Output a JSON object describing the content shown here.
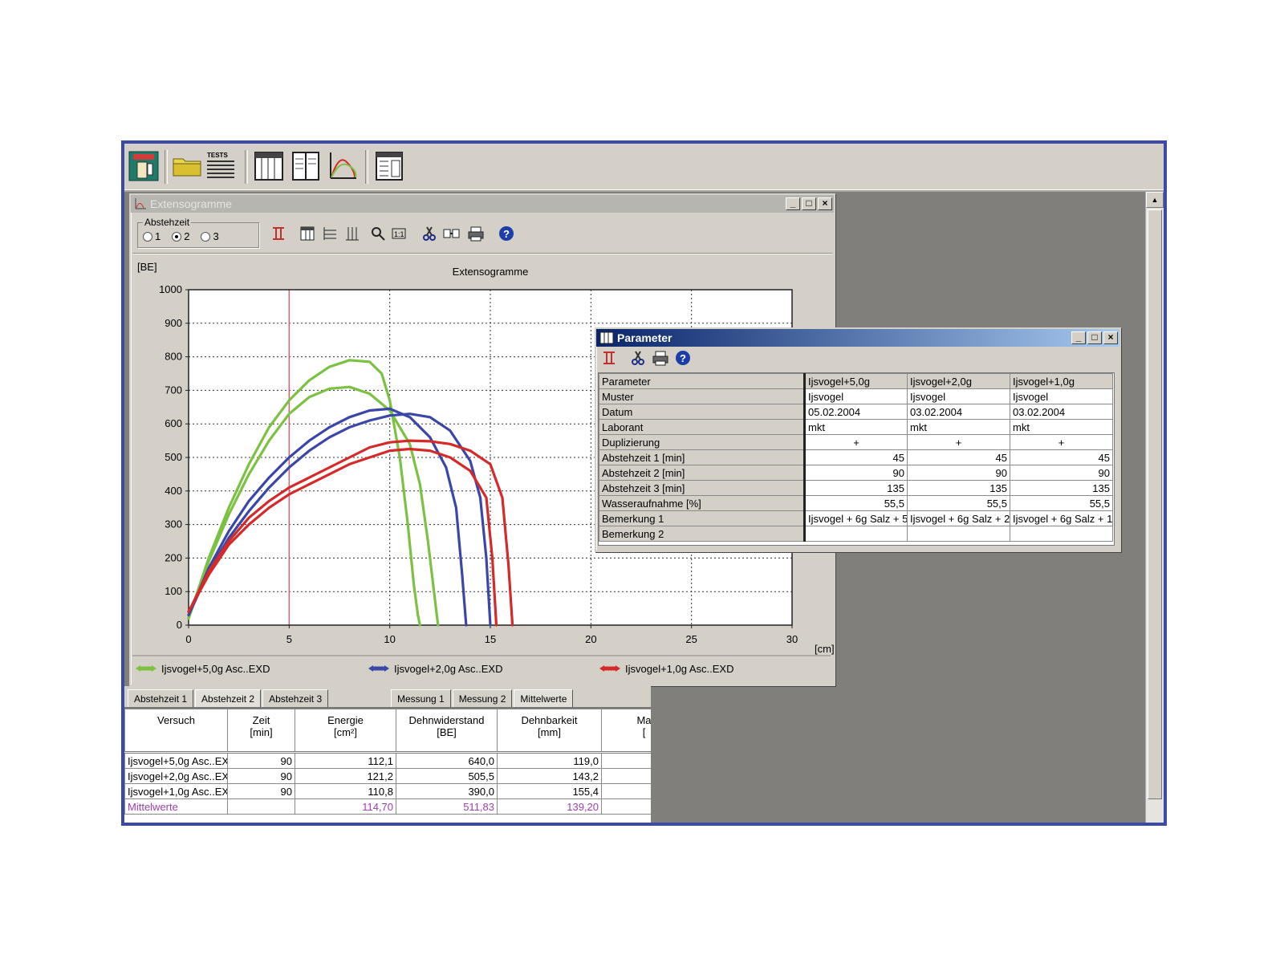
{
  "parameter_window": {
    "title": "Parameter",
    "headers": [
      "Parameter",
      "Ijsvogel+5,0g",
      "Ijsvogel+2,0g",
      "Ijsvogel+1,0g"
    ],
    "rows": [
      [
        "Muster",
        "Ijsvogel",
        "Ijsvogel",
        "Ijsvogel"
      ],
      [
        "Datum",
        "05.02.2004",
        "03.02.2004",
        "03.02.2004"
      ],
      [
        "Laborant",
        "mkt",
        "mkt",
        "mkt"
      ],
      [
        "Duplizierung",
        "+",
        "+",
        "+"
      ],
      [
        "Abstehzeit 1 [min]",
        "45",
        "45",
        "45"
      ],
      [
        "Abstehzeit 2 [min]",
        "90",
        "90",
        "90"
      ],
      [
        "Abstehzeit 3 [min]",
        "135",
        "135",
        "135"
      ],
      [
        "Wasseraufnahme [%]",
        "55,5",
        "55,5",
        "55,5"
      ],
      [
        "Bemerkung 1",
        "Ijsvogel + 6g Salz + 5",
        "Ijsvogel + 6g Salz + 2",
        "Ijsvogel + 6g Salz + 1"
      ],
      [
        "Bemerkung 2",
        "",
        "",
        ""
      ]
    ]
  },
  "results": {
    "tabs_left": [
      "Abstehzeit 1",
      "Abstehzeit 2",
      "Abstehzeit 3"
    ],
    "tabs_right": [
      "Messung 1",
      "Messung 2",
      "Mittelwerte"
    ],
    "headers": [
      {
        "line1": "Versuch",
        "line2": ""
      },
      {
        "line1": "Zeit",
        "line2": "[min]"
      },
      {
        "line1": "Energie",
        "line2": "[cm²]"
      },
      {
        "line1": "Dehnwiderstand",
        "line2": "[BE]"
      },
      {
        "line1": "Dehnbarkeit",
        "line2": "[mm]"
      },
      {
        "line1": "Ma",
        "line2": "["
      }
    ],
    "rows": [
      [
        "Ijsvogel+5,0g Asc..EXD",
        "90",
        "112,1",
        "640,0",
        "119,0",
        ""
      ],
      [
        "Ijsvogel+2,0g Asc..EXD",
        "90",
        "121,2",
        "505,5",
        "143,2",
        ""
      ],
      [
        "Ijsvogel+1,0g Asc..EXD",
        "90",
        "110,8",
        "390,0",
        "155,4",
        ""
      ]
    ],
    "mean_row": [
      "Mittelwerte",
      "",
      "114,70",
      "511,83",
      "139,20",
      ""
    ]
  },
  "colors": {
    "green": "#7cc142",
    "blue": "#3a46a8",
    "red": "#d42a2a",
    "marker": "#e06070",
    "mean_text": "#a040b0"
  },
  "chart_data": {
    "type": "line",
    "title": "Extensogramme",
    "ylabel": "[BE]",
    "xlabel": "[cm]",
    "xlim": [
      0,
      30
    ],
    "ylim": [
      0,
      1000
    ],
    "xticks": [
      0,
      5,
      10,
      15,
      20,
      25,
      30
    ],
    "yticks": [
      0,
      100,
      200,
      300,
      400,
      500,
      600,
      700,
      800,
      900,
      1000
    ],
    "grid": true,
    "marker_x": 5,
    "series": [
      {
        "name": "Ijsvogel+5,0g Asc..EXD",
        "color": "green",
        "x": [
          0,
          1,
          2,
          3,
          4,
          5,
          6,
          7,
          8,
          9,
          9.6,
          10,
          10.5,
          10.9,
          11.2,
          11.4,
          11.5
        ],
        "y": [
          20,
          200,
          350,
          480,
          590,
          670,
          730,
          770,
          790,
          785,
          750,
          670,
          500,
          300,
          120,
          30,
          0
        ]
      },
      {
        "name": "Ijsvogel+5,0g Asc..EXD",
        "color": "green",
        "x": [
          0,
          1,
          2,
          3,
          4,
          5,
          6,
          7,
          8,
          9,
          10,
          11,
          11.5,
          11.9,
          12.2,
          12.4
        ],
        "y": [
          20,
          190,
          330,
          450,
          550,
          630,
          680,
          705,
          710,
          690,
          640,
          540,
          420,
          250,
          100,
          0
        ]
      },
      {
        "name": "Ijsvogel+2,0g Asc..EXD",
        "color": "blue",
        "x": [
          0,
          1,
          2,
          3,
          4,
          5,
          6,
          7,
          8,
          9,
          10,
          11,
          12,
          12.8,
          13.3,
          13.6,
          13.8
        ],
        "y": [
          30,
          170,
          280,
          370,
          440,
          500,
          550,
          590,
          620,
          640,
          645,
          620,
          560,
          470,
          350,
          150,
          0
        ]
      },
      {
        "name": "Ijsvogel+2,0g Asc..EXD",
        "color": "blue",
        "x": [
          0,
          1,
          2,
          3,
          4,
          5,
          6,
          7,
          8,
          9,
          10,
          11,
          12,
          13,
          14,
          14.5,
          14.8,
          15
        ],
        "y": [
          30,
          160,
          260,
          340,
          410,
          470,
          520,
          560,
          590,
          610,
          625,
          630,
          620,
          580,
          490,
          380,
          200,
          0
        ]
      },
      {
        "name": "Ijsvogel+1,0g Asc..EXD",
        "color": "red",
        "x": [
          0,
          1,
          2,
          3,
          4,
          5,
          6,
          7,
          8,
          9,
          10,
          11,
          12,
          13,
          14,
          14.8,
          15.1,
          15.3
        ],
        "y": [
          40,
          150,
          240,
          300,
          350,
          390,
          420,
          450,
          480,
          500,
          520,
          525,
          520,
          500,
          460,
          380,
          200,
          0
        ]
      },
      {
        "name": "Ijsvogel+1,0g Asc..EXD",
        "color": "red",
        "x": [
          0,
          1,
          2,
          3,
          4,
          5,
          6,
          7,
          8,
          9,
          10,
          11,
          12,
          13,
          14,
          15,
          15.6,
          15.9,
          16.1
        ],
        "y": [
          40,
          160,
          250,
          320,
          370,
          410,
          440,
          470,
          500,
          530,
          545,
          550,
          548,
          540,
          520,
          480,
          380,
          180,
          0
        ]
      }
    ],
    "legend": [
      {
        "label": "Ijsvogel+5,0g Asc..EXD",
        "color": "green"
      },
      {
        "label": "Ijsvogel+2,0g Asc..EXD",
        "color": "blue"
      },
      {
        "label": "Ijsvogel+1,0g Asc..EXD",
        "color": "red"
      }
    ]
  },
  "extenso_window": {
    "title": "Extensogramme",
    "group_label": "Abstehzeit",
    "radio_options": [
      "1",
      "2",
      "3"
    ],
    "selected_radio": "2"
  }
}
